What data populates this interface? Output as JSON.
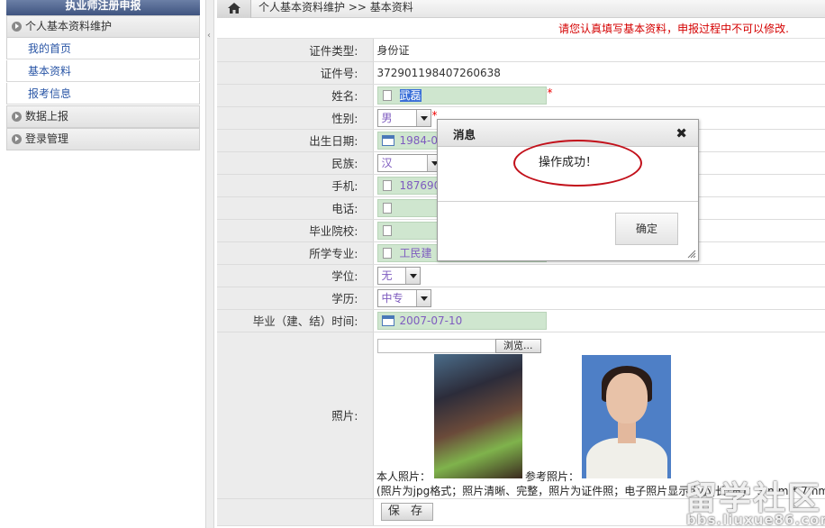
{
  "sidebar": {
    "title": "执业师注册申报",
    "groups": [
      {
        "label": "个人基本资料维护",
        "items": [
          "我的首页",
          "基本资料",
          "报考信息"
        ]
      },
      {
        "label": "数据上报"
      },
      {
        "label": "登录管理"
      }
    ]
  },
  "header": {
    "breadcrumb": "个人基本资料维护 >> 基本资料",
    "notice": "请您认真填写基本资料，申报过程中不可以修改."
  },
  "form": {
    "id_type": {
      "label": "证件类型:",
      "value": "身份证"
    },
    "id_number": {
      "label": "证件号:",
      "value": "372901198407260638"
    },
    "name": {
      "label": "姓名:",
      "value": "武磊",
      "required_mark": "*"
    },
    "gender": {
      "label": "性别:",
      "value": "男",
      "required_mark": "*"
    },
    "birth_date": {
      "label": "出生日期:",
      "value": "1984-0"
    },
    "ethnicity": {
      "label": "民族:",
      "value": "汉"
    },
    "mobile": {
      "label": "手机:",
      "value": "187690"
    },
    "phone": {
      "label": "电话:",
      "value": ""
    },
    "school": {
      "label": "毕业院校:",
      "value": ""
    },
    "major": {
      "label": "所学专业:",
      "value": "工民建"
    },
    "degree": {
      "label": "学位:",
      "value": "无"
    },
    "education": {
      "label": "学历:",
      "value": "中专"
    },
    "grad_date": {
      "label": "毕业（建、结）时间:",
      "value": "2007-07-10"
    },
    "photo": {
      "label": "照片:",
      "browse_label": "浏览...",
      "self_label": "本人照片：",
      "ref_label": "参考照片：",
      "note": "(照片为jpg格式；照片清晰、完整，照片为证件照；电子照片显示大小(长*宽)：3 mm * 7mm"
    },
    "save_label": "保 存"
  },
  "modal": {
    "title": "消息",
    "close_glyph": "✖",
    "message": "操作成功！",
    "ok_label": "确定"
  },
  "watermark": {
    "line1": "留学社区",
    "line2": "bbs.liuxue86.com"
  },
  "colors": {
    "notice": "#d40000",
    "field_bg": "#cfe6cf",
    "field_text": "#7e5bbf",
    "highlight_ring": "#c2101a",
    "sidebar_header": "#3f5480"
  }
}
